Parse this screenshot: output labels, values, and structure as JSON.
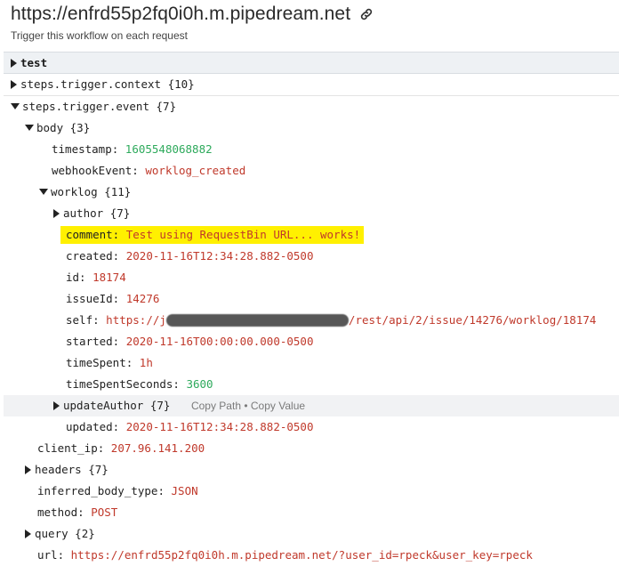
{
  "header": {
    "url": "https://enfrd55p2fq0i0h.m.pipedream.net",
    "subtitle": "Trigger this workflow on each request"
  },
  "tree": {
    "test_label": "test",
    "context": {
      "key": "steps.trigger.context",
      "count": "{10}"
    },
    "event": {
      "key": "steps.trigger.event",
      "count": "{7}"
    },
    "body": {
      "key": "body",
      "count": "{3}"
    },
    "timestamp": {
      "key": "timestamp:",
      "value": "1605548068882"
    },
    "webhookEvent": {
      "key": "webhookEvent:",
      "value": "worklog_created"
    },
    "worklog": {
      "key": "worklog",
      "count": "{11}"
    },
    "author": {
      "key": "author",
      "count": "{7}"
    },
    "comment": {
      "key": "comment:",
      "value": "Test using RequestBin URL... works!"
    },
    "created": {
      "key": "created:",
      "value": "2020-11-16T12:34:28.882-0500"
    },
    "id": {
      "key": "id:",
      "value": "18174"
    },
    "issueId": {
      "key": "issueId:",
      "value": "14276"
    },
    "self": {
      "key": "self:",
      "value_start": "https://",
      "value_j": "j",
      "value_end": "/rest/api/2/issue/14276/worklog/18174"
    },
    "started": {
      "key": "started:",
      "value": "2020-11-16T00:00:00.000-0500"
    },
    "timeSpent": {
      "key": "timeSpent:",
      "value": "1h"
    },
    "timeSpentSeconds": {
      "key": "timeSpentSeconds:",
      "value": "3600"
    },
    "updateAuthor": {
      "key": "updateAuthor",
      "count": "{7}",
      "copy_path": "Copy Path",
      "dot": "•",
      "copy_value": "Copy Value"
    },
    "updated": {
      "key": "updated:",
      "value": "2020-11-16T12:34:28.882-0500"
    },
    "client_ip": {
      "key": "client_ip:",
      "value": "207.96.141.200"
    },
    "headers": {
      "key": "headers",
      "count": "{7}"
    },
    "inferred_body_type": {
      "key": "inferred_body_type:",
      "value": "JSON"
    },
    "method": {
      "key": "method:",
      "value": "POST"
    },
    "query": {
      "key": "query",
      "count": "{2}"
    },
    "url": {
      "key": "url:",
      "value": "https://enfrd55p2fq0i0h.m.pipedream.net/?user_id=rpeck&user_key=rpeck"
    }
  },
  "colors": {
    "string": "#c0392b",
    "number": "#2eaa5c",
    "highlight": "#fff000"
  }
}
